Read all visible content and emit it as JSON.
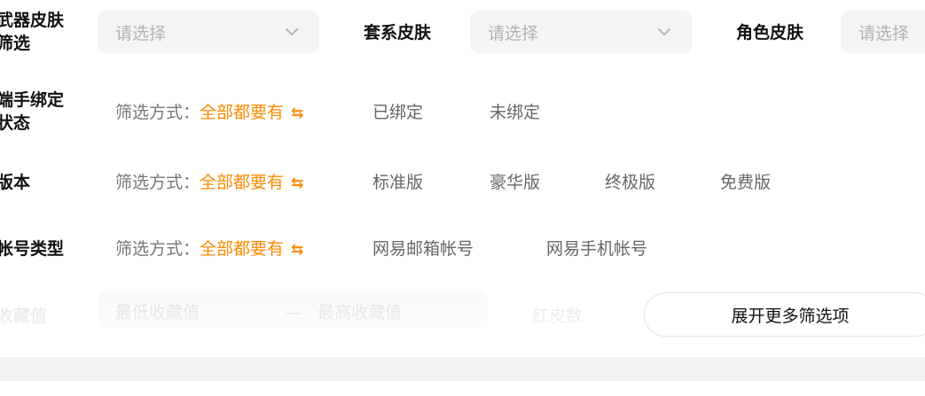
{
  "filters": {
    "weapon_skin": {
      "label_line1": "武器皮肤",
      "label_line2": "筛选",
      "placeholder": "请选择"
    },
    "suit_skin": {
      "label": "套系皮肤",
      "placeholder": "请选择"
    },
    "role_skin": {
      "label": "角色皮肤",
      "placeholder": "请选择"
    },
    "mobile_bind": {
      "label_line1": "端手绑定",
      "label_line2": "状态",
      "mode_prefix": "筛选方式：",
      "mode_value": "全部都要有",
      "options": [
        "已绑定",
        "未绑定"
      ]
    },
    "edition": {
      "label": "版本",
      "mode_prefix": "筛选方式：",
      "mode_value": "全部都要有",
      "options": [
        "标准版",
        "豪华版",
        "终极版",
        "免费版"
      ]
    },
    "account_type": {
      "label": "帐号类型",
      "mode_prefix": "筛选方式：",
      "mode_value": "全部都要有",
      "options": [
        "网易邮箱帐号",
        "网易手机帐号"
      ]
    },
    "favorites": {
      "label": "收藏值",
      "min_placeholder": "最低收藏值",
      "separator": "—",
      "max_placeholder": "最高收藏值"
    },
    "red_skin_count": {
      "label": "红皮数"
    }
  },
  "expand_button": {
    "label": "展开更多筛选项"
  },
  "icons": {
    "swap": "swap-arrows-icon",
    "chevron": "chevron-down-icon"
  },
  "colors": {
    "accent": "#ff8a00"
  }
}
